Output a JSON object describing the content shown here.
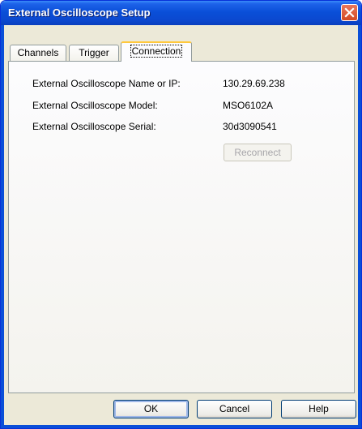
{
  "window": {
    "title": "External Oscilloscope Setup"
  },
  "tabs": [
    {
      "label": "Channels"
    },
    {
      "label": "Trigger"
    },
    {
      "label": "Connection"
    }
  ],
  "connection": {
    "name_label": "External Oscilloscope Name or IP:",
    "name_value": "130.29.69.238",
    "model_label": "External Oscilloscope Model:",
    "model_value": "MSO6102A",
    "serial_label": "External Oscilloscope Serial:",
    "serial_value": "30d3090541",
    "reconnect_label": "Reconnect"
  },
  "buttons": {
    "ok": "OK",
    "cancel": "Cancel",
    "help": "Help"
  },
  "colors": {
    "titlebar": "#0a4fd8",
    "close": "#d34a22",
    "active_tab_accent": "#ffc83c"
  }
}
